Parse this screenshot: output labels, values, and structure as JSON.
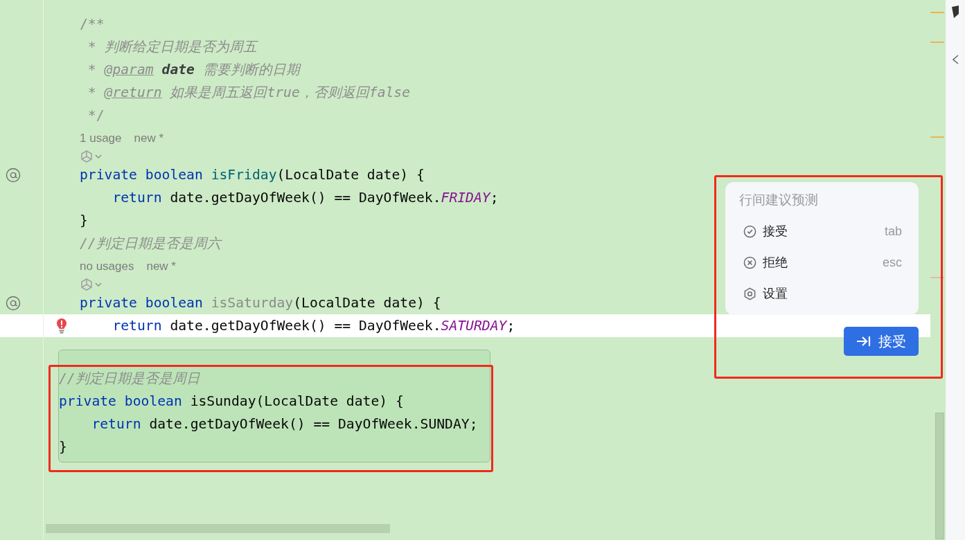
{
  "editor": {
    "lines": [
      {
        "kind": "code",
        "current": false,
        "override": false,
        "error": false,
        "tokens": [
          {
            "kind": "doc",
            "text": "/**"
          }
        ]
      },
      {
        "kind": "code",
        "current": false,
        "override": false,
        "error": false,
        "tokens": [
          {
            "kind": "doc",
            "text": " * "
          },
          {
            "kind": "doc-italic",
            "text": "判断给定日期是否为周五"
          }
        ]
      },
      {
        "kind": "code",
        "current": false,
        "override": false,
        "error": false,
        "tokens": [
          {
            "kind": "doc",
            "text": " * "
          },
          {
            "kind": "doc-tag",
            "text": "@param"
          },
          {
            "kind": "doc-param",
            "text": " date"
          },
          {
            "kind": "doc-italic",
            "text": " 需要判断的日期"
          }
        ]
      },
      {
        "kind": "code",
        "current": false,
        "override": false,
        "error": false,
        "tokens": [
          {
            "kind": "doc",
            "text": " * "
          },
          {
            "kind": "doc-tag",
            "text": "@return"
          },
          {
            "kind": "doc-italic",
            "text": " 如果是周五返回true，否则返回false"
          }
        ]
      },
      {
        "kind": "code",
        "current": false,
        "override": false,
        "error": false,
        "tokens": [
          {
            "kind": "doc",
            "text": " */"
          }
        ]
      },
      {
        "kind": "hint",
        "current": false,
        "override": false,
        "error": false,
        "tokens": [
          {
            "kind": "usage",
            "text": "1 usage"
          },
          {
            "kind": "status",
            "text": "new *"
          }
        ]
      },
      {
        "kind": "ai-icon",
        "current": false,
        "override": false,
        "error": false
      },
      {
        "kind": "code",
        "current": false,
        "override": true,
        "error": false,
        "tokens": [
          {
            "kind": "keyword",
            "text": "private boolean "
          },
          {
            "kind": "method",
            "text": "isFriday"
          },
          {
            "kind": "text",
            "text": "(LocalDate date) {"
          }
        ]
      },
      {
        "kind": "code",
        "current": false,
        "override": false,
        "error": false,
        "tokens": [
          {
            "kind": "keyword",
            "text": "    return "
          },
          {
            "kind": "text",
            "text": "date.getDayOfWeek() == DayOfWeek."
          },
          {
            "kind": "constant",
            "text": "FRIDAY"
          },
          {
            "kind": "text",
            "text": ";"
          }
        ]
      },
      {
        "kind": "code",
        "current": false,
        "override": false,
        "error": false,
        "tokens": [
          {
            "kind": "text",
            "text": "}"
          }
        ]
      },
      {
        "kind": "code",
        "current": false,
        "override": false,
        "error": false,
        "tokens": [
          {
            "kind": "comment",
            "text": "//判定日期是否是周六"
          }
        ]
      },
      {
        "kind": "hint",
        "current": false,
        "override": false,
        "error": false,
        "tokens": [
          {
            "kind": "usage",
            "text": "no usages"
          },
          {
            "kind": "status",
            "text": "new *"
          }
        ]
      },
      {
        "kind": "ai-icon",
        "current": false,
        "override": false,
        "error": false
      },
      {
        "kind": "code",
        "current": false,
        "override": true,
        "error": false,
        "tokens": [
          {
            "kind": "keyword",
            "text": "private boolean "
          },
          {
            "kind": "method-unused",
            "text": "isSaturday"
          },
          {
            "kind": "text",
            "text": "(LocalDate date) {"
          }
        ]
      },
      {
        "kind": "code",
        "current": true,
        "override": false,
        "error": true,
        "tokens": [
          {
            "kind": "keyword",
            "text": "    return "
          },
          {
            "kind": "text",
            "text": "date.getDayOfWeek() == DayOfWeek."
          },
          {
            "kind": "constant",
            "text": "SATURDAY"
          },
          {
            "kind": "text",
            "text": ";"
          }
        ]
      }
    ]
  },
  "completion_preview": {
    "lines": [
      {
        "tokens": [
          {
            "kind": "comment",
            "text": "//判定日期是否是周日"
          }
        ]
      },
      {
        "tokens": [
          {
            "kind": "keyword",
            "text": "private boolean "
          },
          {
            "kind": "text",
            "text": "isSunday(LocalDate date) {"
          }
        ]
      },
      {
        "tokens": [
          {
            "kind": "keyword",
            "text": "    return "
          },
          {
            "kind": "text",
            "text": "date.getDayOfWeek() == DayOfWeek.SUNDAY;"
          }
        ]
      },
      {
        "tokens": [
          {
            "kind": "text",
            "text": "}"
          }
        ]
      }
    ]
  },
  "suggestion_panel": {
    "title": "行间建议预测",
    "items": [
      {
        "kind": "accept",
        "label": "接受",
        "shortcut": "tab"
      },
      {
        "kind": "reject",
        "label": "拒绝",
        "shortcut": "esc"
      },
      {
        "kind": "settings",
        "label": "设置"
      }
    ],
    "accept_button": {
      "label": "接受"
    }
  }
}
